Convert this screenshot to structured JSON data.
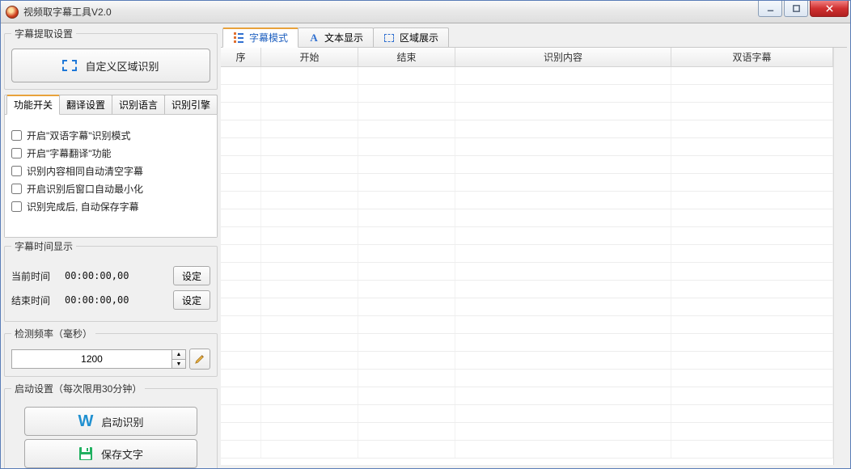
{
  "window": {
    "title": "视频取字幕工具V2.0"
  },
  "left": {
    "extract_group": "字幕提取设置",
    "custom_region_btn": "自定义区域识别",
    "tabs": [
      "功能开关",
      "翻译设置",
      "识别语言",
      "识别引擎"
    ],
    "checks": [
      "开启\"双语字幕\"识别模式",
      "开启\"字幕翻译\"功能",
      "识别内容相同自动清空字幕",
      "开启识别后窗口自动最小化",
      "识别完成后, 自动保存字幕"
    ],
    "time_group": "字幕时间显示",
    "current_time_label": "当前时间",
    "current_time_value": "00:00:00,00",
    "end_time_label": "结束时间",
    "end_time_value": "00:00:00,00",
    "set_btn": "设定",
    "freq_group": "检测频率（毫秒）",
    "freq_value": "1200",
    "start_group": "启动设置（每次限用30分钟）",
    "start_recog_btn": "启动识别",
    "save_text_btn": "保存文字"
  },
  "right": {
    "tabs": [
      "字幕模式",
      "文本显示",
      "区域展示"
    ],
    "columns": [
      "序",
      "开始",
      "结束",
      "识别内容",
      "双语字幕"
    ]
  }
}
